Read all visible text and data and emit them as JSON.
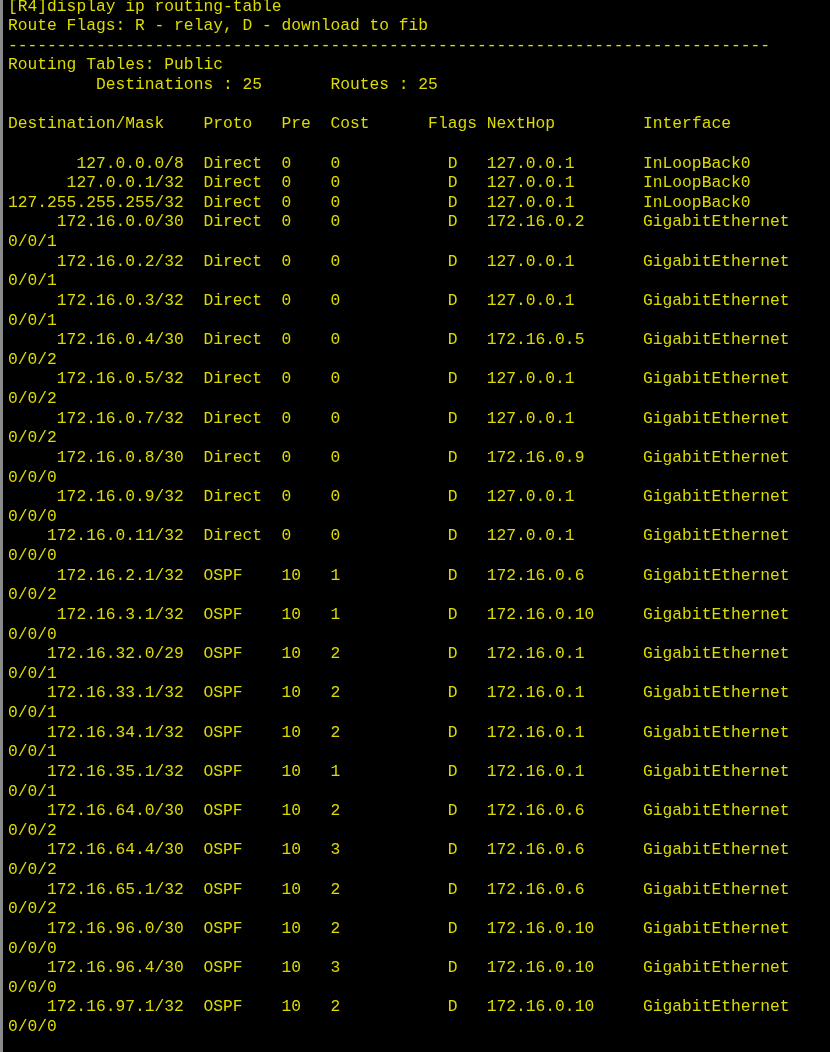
{
  "command": "[R4]display ip routing-table",
  "flags_legend": "Route Flags: R - relay, D - download to fib",
  "separator": "------------------------------------------------------------------------------",
  "table_name": "Routing Tables: Public",
  "summary": {
    "destinations_label": "Destinations : 25",
    "routes_label": "Routes : 25"
  },
  "columns": [
    "Destination/Mask",
    "Proto",
    "Pre",
    "Cost",
    "Flags",
    "NextHop",
    "Interface"
  ],
  "rows": [
    {
      "destination": "127.0.0.0/8",
      "proto": "Direct",
      "pre": "0",
      "cost": "0",
      "flags": "D",
      "nexthop": "127.0.0.1",
      "interface": "InLoopBack0"
    },
    {
      "destination": "127.0.0.1/32",
      "proto": "Direct",
      "pre": "0",
      "cost": "0",
      "flags": "D",
      "nexthop": "127.0.0.1",
      "interface": "InLoopBack0"
    },
    {
      "destination": "127.255.255.255/32",
      "proto": "Direct",
      "pre": "0",
      "cost": "0",
      "flags": "D",
      "nexthop": "127.0.0.1",
      "interface": "InLoopBack0"
    },
    {
      "destination": "172.16.0.0/30",
      "proto": "Direct",
      "pre": "0",
      "cost": "0",
      "flags": "D",
      "nexthop": "172.16.0.2",
      "interface": "GigabitEthernet",
      "interface_wrap": "0/0/1"
    },
    {
      "destination": "172.16.0.2/32",
      "proto": "Direct",
      "pre": "0",
      "cost": "0",
      "flags": "D",
      "nexthop": "127.0.0.1",
      "interface": "GigabitEthernet",
      "interface_wrap": "0/0/1"
    },
    {
      "destination": "172.16.0.3/32",
      "proto": "Direct",
      "pre": "0",
      "cost": "0",
      "flags": "D",
      "nexthop": "127.0.0.1",
      "interface": "GigabitEthernet",
      "interface_wrap": "0/0/1"
    },
    {
      "destination": "172.16.0.4/30",
      "proto": "Direct",
      "pre": "0",
      "cost": "0",
      "flags": "D",
      "nexthop": "172.16.0.5",
      "interface": "GigabitEthernet",
      "interface_wrap": "0/0/2"
    },
    {
      "destination": "172.16.0.5/32",
      "proto": "Direct",
      "pre": "0",
      "cost": "0",
      "flags": "D",
      "nexthop": "127.0.0.1",
      "interface": "GigabitEthernet",
      "interface_wrap": "0/0/2"
    },
    {
      "destination": "172.16.0.7/32",
      "proto": "Direct",
      "pre": "0",
      "cost": "0",
      "flags": "D",
      "nexthop": "127.0.0.1",
      "interface": "GigabitEthernet",
      "interface_wrap": "0/0/2"
    },
    {
      "destination": "172.16.0.8/30",
      "proto": "Direct",
      "pre": "0",
      "cost": "0",
      "flags": "D",
      "nexthop": "172.16.0.9",
      "interface": "GigabitEthernet",
      "interface_wrap": "0/0/0"
    },
    {
      "destination": "172.16.0.9/32",
      "proto": "Direct",
      "pre": "0",
      "cost": "0",
      "flags": "D",
      "nexthop": "127.0.0.1",
      "interface": "GigabitEthernet",
      "interface_wrap": "0/0/0"
    },
    {
      "destination": "172.16.0.11/32",
      "proto": "Direct",
      "pre": "0",
      "cost": "0",
      "flags": "D",
      "nexthop": "127.0.0.1",
      "interface": "GigabitEthernet",
      "interface_wrap": "0/0/0"
    },
    {
      "destination": "172.16.2.1/32",
      "proto": "OSPF",
      "pre": "10",
      "cost": "1",
      "flags": "D",
      "nexthop": "172.16.0.6",
      "interface": "GigabitEthernet",
      "interface_wrap": "0/0/2"
    },
    {
      "destination": "172.16.3.1/32",
      "proto": "OSPF",
      "pre": "10",
      "cost": "1",
      "flags": "D",
      "nexthop": "172.16.0.10",
      "interface": "GigabitEthernet",
      "interface_wrap": "0/0/0"
    },
    {
      "destination": "172.16.32.0/29",
      "proto": "OSPF",
      "pre": "10",
      "cost": "2",
      "flags": "D",
      "nexthop": "172.16.0.1",
      "interface": "GigabitEthernet",
      "interface_wrap": "0/0/1"
    },
    {
      "destination": "172.16.33.1/32",
      "proto": "OSPF",
      "pre": "10",
      "cost": "2",
      "flags": "D",
      "nexthop": "172.16.0.1",
      "interface": "GigabitEthernet",
      "interface_wrap": "0/0/1"
    },
    {
      "destination": "172.16.34.1/32",
      "proto": "OSPF",
      "pre": "10",
      "cost": "2",
      "flags": "D",
      "nexthop": "172.16.0.1",
      "interface": "GigabitEthernet",
      "interface_wrap": "0/0/1"
    },
    {
      "destination": "172.16.35.1/32",
      "proto": "OSPF",
      "pre": "10",
      "cost": "1",
      "flags": "D",
      "nexthop": "172.16.0.1",
      "interface": "GigabitEthernet",
      "interface_wrap": "0/0/1"
    },
    {
      "destination": "172.16.64.0/30",
      "proto": "OSPF",
      "pre": "10",
      "cost": "2",
      "flags": "D",
      "nexthop": "172.16.0.6",
      "interface": "GigabitEthernet",
      "interface_wrap": "0/0/2"
    },
    {
      "destination": "172.16.64.4/30",
      "proto": "OSPF",
      "pre": "10",
      "cost": "3",
      "flags": "D",
      "nexthop": "172.16.0.6",
      "interface": "GigabitEthernet",
      "interface_wrap": "0/0/2"
    },
    {
      "destination": "172.16.65.1/32",
      "proto": "OSPF",
      "pre": "10",
      "cost": "2",
      "flags": "D",
      "nexthop": "172.16.0.6",
      "interface": "GigabitEthernet",
      "interface_wrap": "0/0/2"
    },
    {
      "destination": "172.16.96.0/30",
      "proto": "OSPF",
      "pre": "10",
      "cost": "2",
      "flags": "D",
      "nexthop": "172.16.0.10",
      "interface": "GigabitEthernet",
      "interface_wrap": "0/0/0"
    },
    {
      "destination": "172.16.96.4/30",
      "proto": "OSPF",
      "pre": "10",
      "cost": "3",
      "flags": "D",
      "nexthop": "172.16.0.10",
      "interface": "GigabitEthernet",
      "interface_wrap": "0/0/0"
    },
    {
      "destination": "172.16.97.1/32",
      "proto": "OSPF",
      "pre": "10",
      "cost": "2",
      "flags": "D",
      "nexthop": "172.16.0.10",
      "interface": "GigabitEthernet",
      "interface_wrap": "0/0/0"
    }
  ]
}
